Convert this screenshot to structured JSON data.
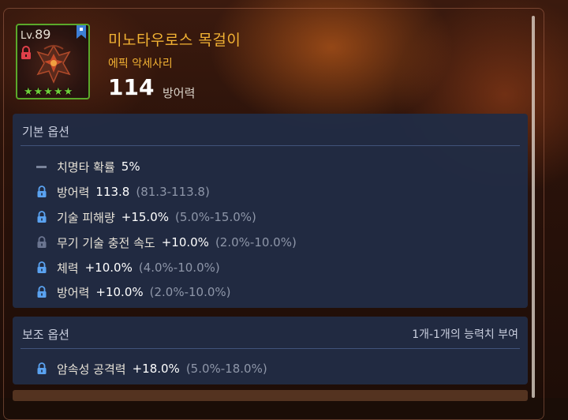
{
  "item": {
    "level_prefix": "Lv.",
    "level": "89",
    "name": "미노타우로스 목걸이",
    "type": "에픽 악세사리",
    "stat_value": "114",
    "stat_label": "방어력",
    "stars": "★★★★★",
    "grade_color": "#5aa82a",
    "name_color": "#f2b233"
  },
  "basic_options": {
    "title": "기본 옵션",
    "rows": [
      {
        "icon": "dash-icon",
        "name": "치명타 확률",
        "value": "5%",
        "range": ""
      },
      {
        "icon": "lock-icon",
        "name": "방어력",
        "value": "113.8",
        "range": "(81.3-113.8)"
      },
      {
        "icon": "lock-icon",
        "name": "기술 피해량",
        "value": "+15.0%",
        "range": "(5.0%-15.0%)"
      },
      {
        "icon": "lock-dim-icon",
        "name": "무기 기술 충전 속도",
        "value": "+10.0%",
        "range": "(2.0%-10.0%)"
      },
      {
        "icon": "lock-icon",
        "name": "체력",
        "value": "+10.0%",
        "range": "(4.0%-10.0%)"
      },
      {
        "icon": "lock-icon",
        "name": "방어력",
        "value": "+10.0%",
        "range": "(2.0%-10.0%)"
      }
    ]
  },
  "sub_options": {
    "title": "보조 옵션",
    "note": "1개-1개의 능력치 부여",
    "rows": [
      {
        "icon": "lock-icon",
        "name": "암속성 공격력",
        "value": "+18.0%",
        "range": "(5.0%-18.0%)"
      }
    ]
  }
}
